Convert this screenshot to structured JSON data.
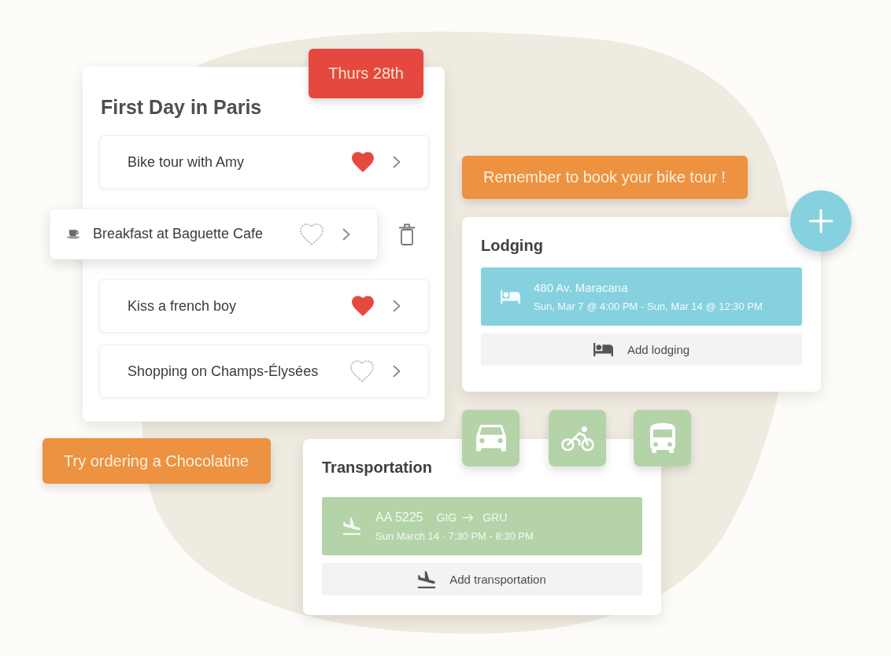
{
  "day_card": {
    "date_badge": "Thurs 28th",
    "title": "First Day in Paris",
    "items": [
      {
        "label": "Bike tour with Amy",
        "liked": true,
        "dragging": false
      },
      {
        "label": "Breakfast at Baguette Cafe",
        "liked": false,
        "dragging": true
      },
      {
        "label": "Kiss a french boy",
        "liked": true,
        "dragging": false
      },
      {
        "label": "Shopping on Champs-Élysées",
        "liked": false,
        "dragging": false
      }
    ]
  },
  "notes": [
    {
      "text": "Remember to book your bike tour !"
    },
    {
      "text": "Try ordering a Chocolatine"
    }
  ],
  "lodging": {
    "title": "Lodging",
    "entry": {
      "address": "480 Av. Maracana",
      "dates": "Sun, Mar 7 @ 4:00 PM - Sun, Mar 14 @ 12:30 PM"
    },
    "add_button": "Add lodging"
  },
  "transportation": {
    "title": "Transportation",
    "entry": {
      "flight": "AA 5225",
      "from": "GIG",
      "to": "GRU",
      "times": "Sun March 14 · 7:30 PM - 8:30 PM"
    },
    "add_button": "Add transportation"
  }
}
